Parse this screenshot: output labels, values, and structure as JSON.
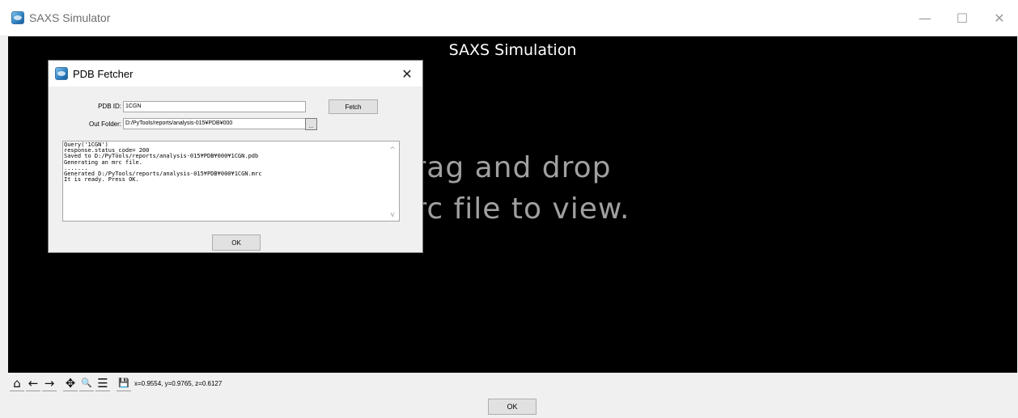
{
  "window": {
    "title": "SAXS Simulator",
    "minimize_glyph": "—",
    "maximize_glyph": "☐",
    "close_glyph": "✕"
  },
  "canvas": {
    "title": "SAXS Simulation",
    "drop_hint_line1": "rag and drop",
    "drop_hint_line2": "nrc file to view."
  },
  "toolbar": {
    "icons": [
      "home-icon",
      "back-icon",
      "forward-icon",
      "pan-icon",
      "zoom-icon",
      "configure-subplots-icon",
      "save-icon"
    ],
    "home": "⌂",
    "back": "←",
    "forward": "→",
    "pan": "✥",
    "zoom": "🔍",
    "configure": "☰",
    "save": "💾",
    "coordinates": "x=0.9554, y=0.9765, z=0.6127"
  },
  "main_ok_label": "OK",
  "dialog": {
    "title": "PDB Fetcher",
    "close_glyph": "✕",
    "pdb_id_label": "PDB ID:",
    "pdb_id_value": "1CGN",
    "out_folder_label": "Out Folder:",
    "out_folder_value": "D:/PyTools/reports/analysis-015¥PDB¥000",
    "fetch_label": "Fetch",
    "browse_label": "...",
    "log": "Query('1CGN')\nresponse.status_code= 200\nSaved to D:/PyTools/reports/analysis-015¥PDB¥000¥1CGN.pdb\nGenerating an mrc file.\n.......\nGenerated D:/PyTools/reports/analysis-015¥PDB¥000¥1CGN.mrc\nIt is ready. Press OK.",
    "scroll_up": "^",
    "scroll_down": "v",
    "ok_label": "OK"
  },
  "colors": {
    "canvas_bg": "#000000",
    "drop_hint": "#a0a0a0",
    "window_bg": "#f0f0f0",
    "button_bg": "#e1e1e1"
  }
}
